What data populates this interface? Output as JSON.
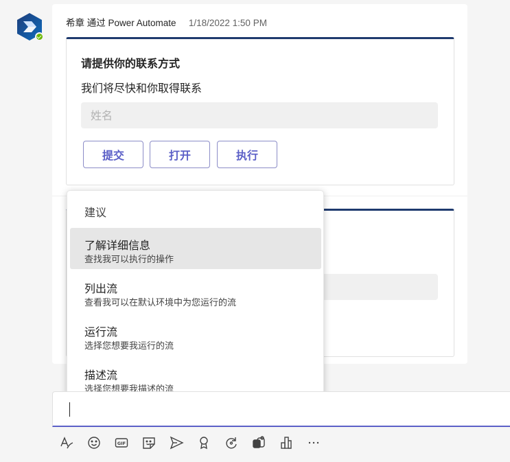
{
  "message": {
    "sender": "希章 通过 Power Automate",
    "timestamp": "1/18/2022 1:50 PM"
  },
  "card1": {
    "title": "请提供你的联系方式",
    "subtitle": "我们将尽快和你取得联系",
    "name_placeholder": "姓名",
    "buttons": [
      "提交",
      "打开",
      "执行"
    ]
  },
  "suggestions": {
    "header": "建议",
    "items": [
      {
        "title": "了解详细信息",
        "desc": "查找我可以执行的操作"
      },
      {
        "title": "列出流",
        "desc": "查看我可以在默认环境中为您运行的流"
      },
      {
        "title": "运行流",
        "desc": "选择您想要我运行的流"
      },
      {
        "title": "描述流",
        "desc": "选择您想要我描述的流"
      }
    ]
  },
  "compose": {
    "value": ""
  },
  "toolbar": {
    "icons": [
      "format-icon",
      "emoji-icon",
      "gif-icon",
      "sticker-icon",
      "send-icon",
      "praise-icon",
      "loop-icon",
      "teams-app-icon",
      "more-apps-icon",
      "more-icon"
    ]
  },
  "colors": {
    "accent": "#5b5fc7",
    "card_top": "#1f3a6e",
    "presence": "#6bb700"
  }
}
